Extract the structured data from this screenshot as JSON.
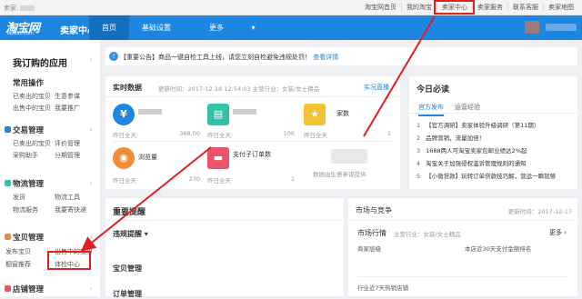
{
  "topbar": {
    "user_label": "卖家:",
    "links": [
      "淘宝网首页",
      "我的淘宝",
      "卖家中心",
      "卖家服务",
      "联系客服",
      "卖家地图"
    ],
    "highlighted": "卖家中心"
  },
  "header": {
    "logo": "淘宝网",
    "logo_sub": "Taobao.com",
    "title": "卖家中心",
    "nav": [
      "首页",
      "基础设置",
      "更多"
    ],
    "active_nav": "首页",
    "more_arrow": "▾"
  },
  "sidebar": {
    "title": "我订购的应用",
    "section_common": "常用操作",
    "common_links": [
      "已卖出的宝贝",
      "生意参谋",
      "出售中的宝贝",
      "我要推广"
    ],
    "section_trade": "交易管理",
    "trade_links": [
      "已卖出的宝贝",
      "评价管理",
      "采购助手",
      "分期管理"
    ],
    "section_logistics": "物流管理",
    "logistics_links": [
      "发货",
      "物流工具",
      "物流服务",
      "我要寄快递"
    ],
    "section_goods": "宝贝管理",
    "goods_links": [
      "发布宝贝",
      "出售中的宝贝",
      "橱窗推荐",
      "体检中心"
    ],
    "section_shop": "店铺管理",
    "colors": {
      "accent": "#1d86e0",
      "highlight": "#e02020"
    }
  },
  "notice": {
    "text": "【重要公告】商品一键自检工具上线，请您立刻自检避免违规处罚！",
    "link": "查看详情"
  },
  "realtime": {
    "title": "实时数据",
    "meta": "更新时间：2017-12-18 12:54:03   主营行业：女装/女士精品",
    "live_link": "实况直播",
    "cards": [
      {
        "label": "",
        "foot": "昨日全天",
        "value": "368.00",
        "color": "#1d86e0",
        "icon": "yen-icon"
      },
      {
        "label": "",
        "foot": "昨日全天",
        "value": "106",
        "color": "#32c2a6",
        "icon": "chart-icon"
      },
      {
        "label": "家数",
        "foot": "昨日全天",
        "value": "1",
        "color": "#f2c230",
        "icon": "star-icon"
      },
      {
        "label": "浏览量",
        "foot": "昨日全天",
        "value": "230",
        "color": "#f08c3a",
        "icon": "eye-icon"
      },
      {
        "label": "支付子订单数",
        "foot": "昨日全天",
        "value": "1",
        "color": "#e8556a",
        "icon": "card-icon"
      },
      {
        "label": "数据由生意参谋提供",
        "foot": "",
        "value": "",
        "color": "#cccccc",
        "icon": "logo-icon"
      }
    ]
  },
  "today": {
    "title": "今日必读",
    "tabs": [
      "官方发布",
      "运营经验"
    ],
    "active_tab": "官方发布",
    "items": [
      {
        "n": "1",
        "text": "【官方调研】卖家体验升级调研（第11期）"
      },
      {
        "n": "2",
        "text": "品牌营销，流量加倍！"
      },
      {
        "n": "3",
        "text": "1688两人可淘宝卖家包邮业绩达2%起"
      },
      {
        "n": "4",
        "text": "淘宝关于加强侵权滥诉管理规则的通知"
      },
      {
        "n": "5",
        "text": "【小微贷款】玩转订单贷款技巧解，营运一瞬就够"
      }
    ]
  },
  "alerts": {
    "title": "重要提醒",
    "items": [
      "违规提醒",
      "宝贝管理",
      "订单管理"
    ],
    "chevron": "▾"
  },
  "market": {
    "title": "市场与竞争",
    "update": "更新时间：2017-12-17",
    "sub_title": "市场行情",
    "sub_meta": "主营行业：女装/女士精品",
    "more": "更多 ›",
    "col1": "商家层级",
    "col2": "本店近30天支付金额排名",
    "foot": "行业近7天热销店铺"
  }
}
